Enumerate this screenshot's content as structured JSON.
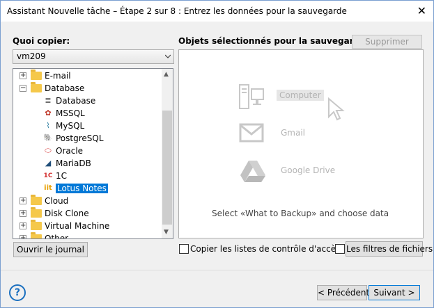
{
  "window": {
    "title": "Assistant Nouvelle tâche – Étape 2 sur 8 : Entrez les données pour la sauvegarde",
    "close": "✕"
  },
  "left": {
    "label": "Quoi copier:",
    "combo_value": "vm209",
    "tree": [
      {
        "label": "E-mail",
        "expand": "+"
      },
      {
        "label": "Database",
        "expand": "−"
      },
      {
        "label": "Database",
        "icon": "≣"
      },
      {
        "label": "MSSQL",
        "icon": "✿"
      },
      {
        "label": "MySQL",
        "icon": "⌇"
      },
      {
        "label": "PostgreSQL",
        "icon": "🐘"
      },
      {
        "label": "Oracle",
        "icon": "⬭"
      },
      {
        "label": "MariaDB",
        "icon": "◢"
      },
      {
        "label": "1C",
        "icon": "1C"
      },
      {
        "label": "Lotus Notes",
        "icon": "iit"
      },
      {
        "label": "Cloud",
        "expand": "+"
      },
      {
        "label": "Disk Clone",
        "expand": "+"
      },
      {
        "label": "Virtual Machine",
        "expand": "+"
      },
      {
        "label": "Other",
        "expand": "+"
      }
    ],
    "journal_button": "Ouvrir le journal"
  },
  "right": {
    "label": "Objets sélectionnés pour la sauvegarde",
    "delete_button": "Supprimer",
    "items": {
      "computer": "Computer",
      "gmail": "Gmail",
      "drive": "Google Drive"
    },
    "hint": "Select «What to Backup» and choose data",
    "acl_checkbox": "Copier les listes de contrôle d'accès",
    "filters_button": "Les filtres de fichiers"
  },
  "footer": {
    "help": "?",
    "prev": "< Précédent",
    "next": "Suivant >"
  },
  "colors": {
    "selection": "#0078d7",
    "accent": "#1a6fbf"
  }
}
